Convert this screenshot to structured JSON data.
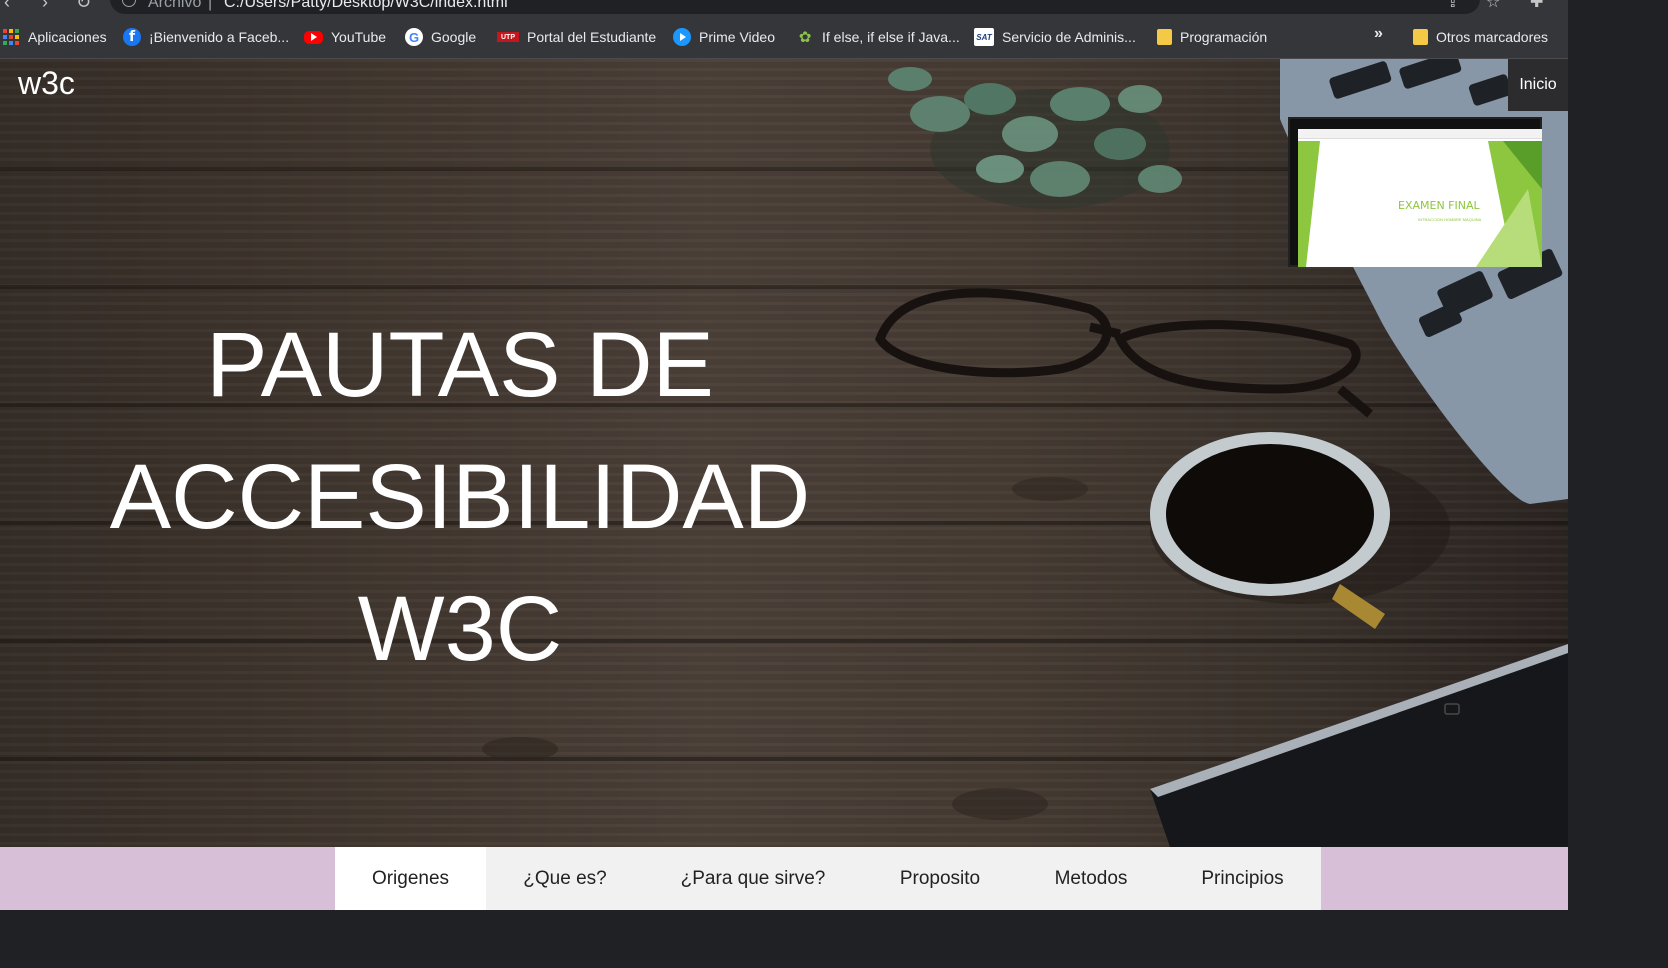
{
  "browser": {
    "url_scheme": "Archivo",
    "url_separator": "|",
    "url": "C:/Users/Patty/Desktop/W3C/index.html",
    "bookmarks": [
      {
        "label": "Aplicaciones",
        "icon": "apps-grid-icon"
      },
      {
        "label": "¡Bienvenido a Faceb...",
        "icon": "facebook-icon"
      },
      {
        "label": "YouTube",
        "icon": "youtube-icon"
      },
      {
        "label": "Google",
        "icon": "google-icon"
      },
      {
        "label": "Portal del Estudiante",
        "icon": "utp-icon"
      },
      {
        "label": "Prime Video",
        "icon": "prime-video-icon"
      },
      {
        "label": "If else, if else if Java...",
        "icon": "ifelse-icon"
      },
      {
        "label": "Servicio de Adminis...",
        "icon": "sat-icon"
      },
      {
        "label": "Programación",
        "icon": "folder-icon"
      }
    ],
    "overflow_chevron": "»",
    "other_bookmarks": "Otros marcadores",
    "icon_glyphs": {
      "fb": "f",
      "google": "G",
      "utp": "UTP",
      "ifelse": "✿",
      "sat": "SAT"
    }
  },
  "site": {
    "logo": "w3c",
    "nav_inicio": "Inicio",
    "hero_title_lines": [
      "PAUTAS DE",
      "ACCESIBILIDAD",
      "W3C"
    ],
    "thumbnail": {
      "title": "EXAMEN FINAL",
      "subtitle": "INTRACCION HOMBRE MAQUINA"
    },
    "tabs": [
      {
        "label": "Origenes",
        "active": true
      },
      {
        "label": "¿Que es?",
        "active": false
      },
      {
        "label": "¿Para que sirve?",
        "active": false
      },
      {
        "label": "Proposito",
        "active": false
      },
      {
        "label": "Metodos",
        "active": false
      },
      {
        "label": "Principios",
        "active": false
      }
    ]
  },
  "colors": {
    "tabbar_bg": "#d8bfd8",
    "tabs_bg": "#f1f1f1",
    "active_tab": "#ffffff",
    "slide_accent": "#8dc63f"
  }
}
